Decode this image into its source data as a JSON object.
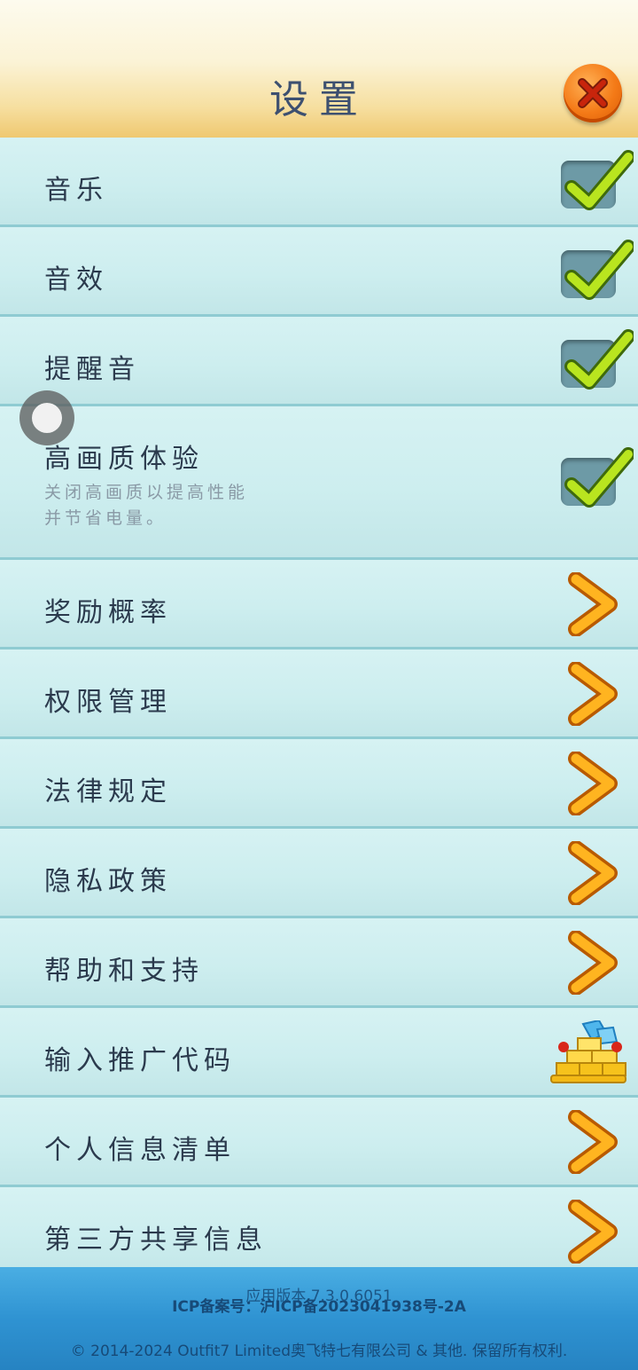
{
  "header": {
    "title": "设置",
    "close_icon": "close-icon"
  },
  "settings": [
    {
      "label": "音乐",
      "control": "checkbox",
      "checked": true
    },
    {
      "label": "音效",
      "control": "checkbox",
      "checked": true
    },
    {
      "label": "提醒音",
      "control": "checkbox",
      "checked": true
    },
    {
      "label": "高画质体验",
      "sub_line1": "关闭高画质以提高性能",
      "sub_line2": "并节省电量。",
      "control": "checkbox",
      "checked": true
    },
    {
      "label": "奖励概率",
      "control": "chevron-right-icon"
    },
    {
      "label": "权限管理",
      "control": "chevron-right-icon"
    },
    {
      "label": "法律规定",
      "control": "chevron-right-icon"
    },
    {
      "label": "隐私政策",
      "control": "chevron-right-icon"
    },
    {
      "label": "帮助和支持",
      "control": "chevron-right-icon"
    },
    {
      "label": "输入推广代码",
      "control": "gold-bars-gift-icon"
    },
    {
      "label": "个人信息清单",
      "control": "chevron-right-icon"
    },
    {
      "label": "第三方共享信息",
      "control": "chevron-right-icon"
    }
  ],
  "footer": {
    "version": "应用版本 7.3.0.6051",
    "icp": "ICP备案号：沪ICP备2023041938号-2A",
    "copyright": "© 2014-2024 Outfit7 Limited奥飞特七有限公司 & 其他. 保留所有权利."
  },
  "colors": {
    "accent_orange": "#f47a17",
    "check_green": "#a8d91a",
    "row_bg": "#cdeeef",
    "footer_blue": "#2f93d2"
  }
}
